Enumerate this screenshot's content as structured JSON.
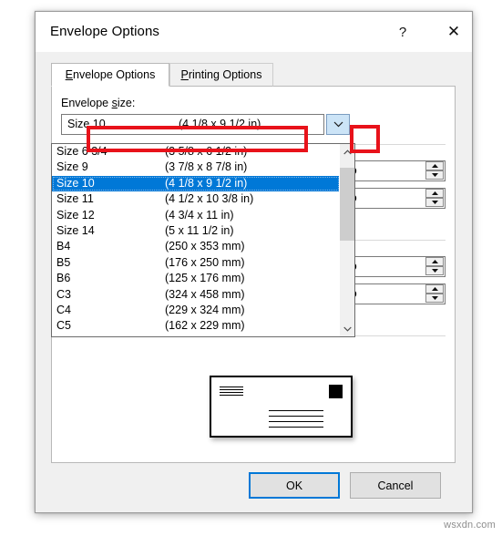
{
  "dialog": {
    "title": "Envelope Options",
    "help_button": "?",
    "close_button": "✕"
  },
  "tabs": [
    {
      "label": "Envelope Options",
      "accel": "E",
      "selected": true
    },
    {
      "label": "Printing Options",
      "accel": "P",
      "selected": false
    }
  ],
  "envelope_size": {
    "label": "Envelope size:",
    "label_accel": "s",
    "selected_name": "Size 10",
    "selected_dims": "(4 1/8 x 9 1/2 in)",
    "dropdown_open": true,
    "options": [
      {
        "name": "Size 6 3/4",
        "dims": "(3 5/8 x 6 1/2 in)",
        "selected": false
      },
      {
        "name": "Size 9",
        "dims": "(3 7/8 x 8 7/8 in)",
        "selected": false
      },
      {
        "name": "Size 10",
        "dims": "(4 1/8 x 9 1/2 in)",
        "selected": true
      },
      {
        "name": "Size 11",
        "dims": "(4 1/2 x 10 3/8 in)",
        "selected": false
      },
      {
        "name": "Size 12",
        "dims": "(4 3/4 x 11 in)",
        "selected": false
      },
      {
        "name": "Size 14",
        "dims": "(5 x 11 1/2 in)",
        "selected": false
      },
      {
        "name": "B4",
        "dims": "(250 x 353 mm)",
        "selected": false
      },
      {
        "name": "B5",
        "dims": "(176 x 250 mm)",
        "selected": false
      },
      {
        "name": "B6",
        "dims": "(125 x 176 mm)",
        "selected": false
      },
      {
        "name": "C3",
        "dims": "(324 x 458 mm)",
        "selected": false
      },
      {
        "name": "C4",
        "dims": "(229 x 324 mm)",
        "selected": false
      },
      {
        "name": "C5",
        "dims": "(162 x 229 mm)",
        "selected": false
      }
    ]
  },
  "spinners": [
    {
      "value": "Auto"
    },
    {
      "value": "Auto"
    },
    {
      "value": "Auto"
    },
    {
      "value": "Auto"
    }
  ],
  "footer": {
    "ok_label": "OK",
    "cancel_label": "Cancel"
  },
  "annotations": {
    "highlight_color": "#e8121a",
    "boxes": [
      {
        "target": "envelope-size-combo"
      },
      {
        "target": "combo-arrow-button"
      }
    ]
  },
  "watermark": "wsxdn.com",
  "colors": {
    "selection_blue": "#0078d7",
    "dialog_background": "#f0f0f0",
    "panel_background": "#ffffff",
    "hover_blue": "#cce4f7"
  }
}
